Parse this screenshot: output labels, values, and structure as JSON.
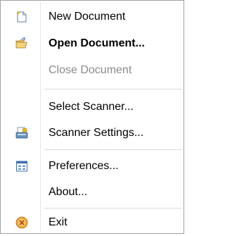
{
  "menu": {
    "items": [
      {
        "label": "New Document",
        "icon": "new-document-icon",
        "bold": false,
        "disabled": false
      },
      {
        "label": "Open Document...",
        "icon": "open-folder-icon",
        "bold": true,
        "disabled": false
      },
      {
        "label": "Close Document",
        "icon": "",
        "bold": false,
        "disabled": true
      },
      {
        "label": "Select Scanner...",
        "icon": "",
        "bold": false,
        "disabled": false
      },
      {
        "label": "Scanner Settings...",
        "icon": "scanner-icon",
        "bold": false,
        "disabled": false
      },
      {
        "label": "Preferences...",
        "icon": "preferences-icon",
        "bold": false,
        "disabled": false
      },
      {
        "label": "About...",
        "icon": "",
        "bold": false,
        "disabled": false
      },
      {
        "label": "Exit",
        "icon": "exit-icon",
        "bold": false,
        "disabled": false
      }
    ]
  },
  "colors": {
    "disabled_text": "#8a8a8a",
    "border": "#a0a0a0",
    "separator": "#d9d9d9"
  }
}
